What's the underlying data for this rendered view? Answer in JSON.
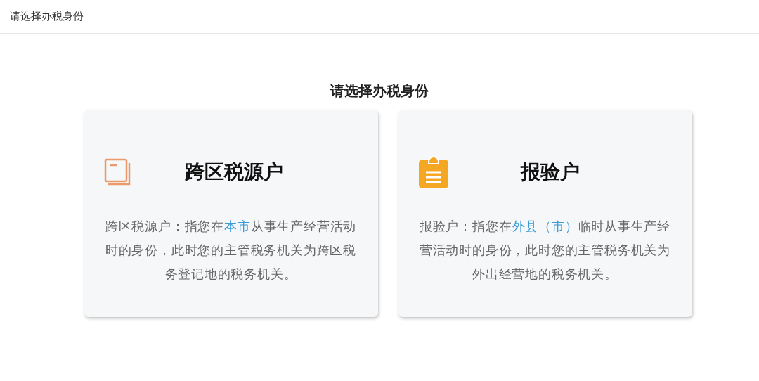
{
  "header": {
    "title": "请选择办税身份"
  },
  "heading": "请选择办税身份",
  "cards": [
    {
      "kind": "book",
      "name": "跨区税源户",
      "description": [
        {
          "text": "跨区税源户：指您在",
          "highlight": false
        },
        {
          "text": "本市",
          "highlight": true
        },
        {
          "text": "从事生产经营活动时的身份，此时您的主管税务机关为跨区税务登记地的税务机关。",
          "highlight": false
        }
      ]
    },
    {
      "kind": "clipboard",
      "name": "报验户",
      "description": [
        {
          "text": "报验户：指您在",
          "highlight": false
        },
        {
          "text": "外县（市）",
          "highlight": true
        },
        {
          "text": "临时从事生产经营活动时的身份，此时您的主管税务机关为外出经营地的税务机关。",
          "highlight": false
        }
      ]
    }
  ]
}
